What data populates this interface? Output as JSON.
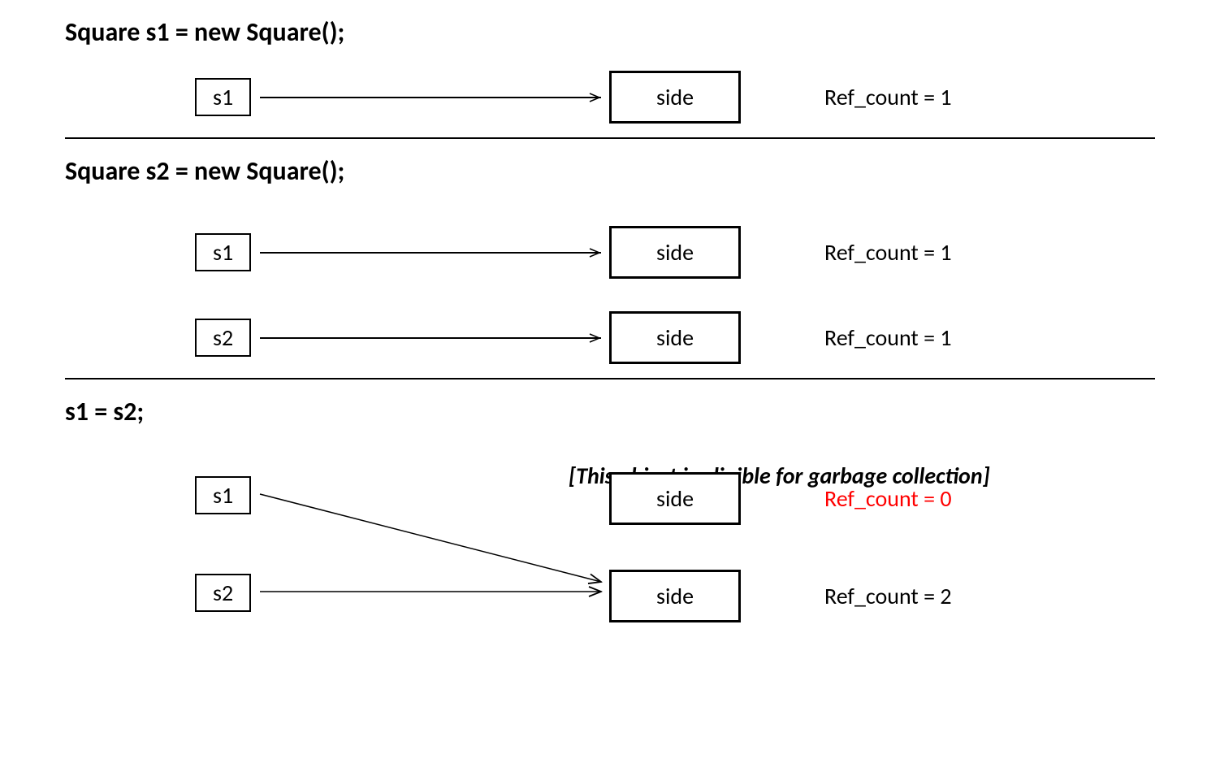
{
  "section1": {
    "code": "Square s1 = new Square();",
    "var1": "s1",
    "obj1": "side",
    "ref1": "Ref_count = 1"
  },
  "section2": {
    "code": "Square s2 = new Square();",
    "var1": "s1",
    "obj1": "side",
    "ref1": "Ref_count = 1",
    "var2": "s2",
    "obj2": "side",
    "ref2": "Ref_count = 1"
  },
  "section3": {
    "code": "s1  =  s2;",
    "annotation": "[This object is eligible for garbage collection]",
    "var1": "s1",
    "obj1": "side",
    "ref1": "Ref_count = 0",
    "var2": "s2",
    "obj2": "side",
    "ref2": "Ref_count = 2"
  }
}
